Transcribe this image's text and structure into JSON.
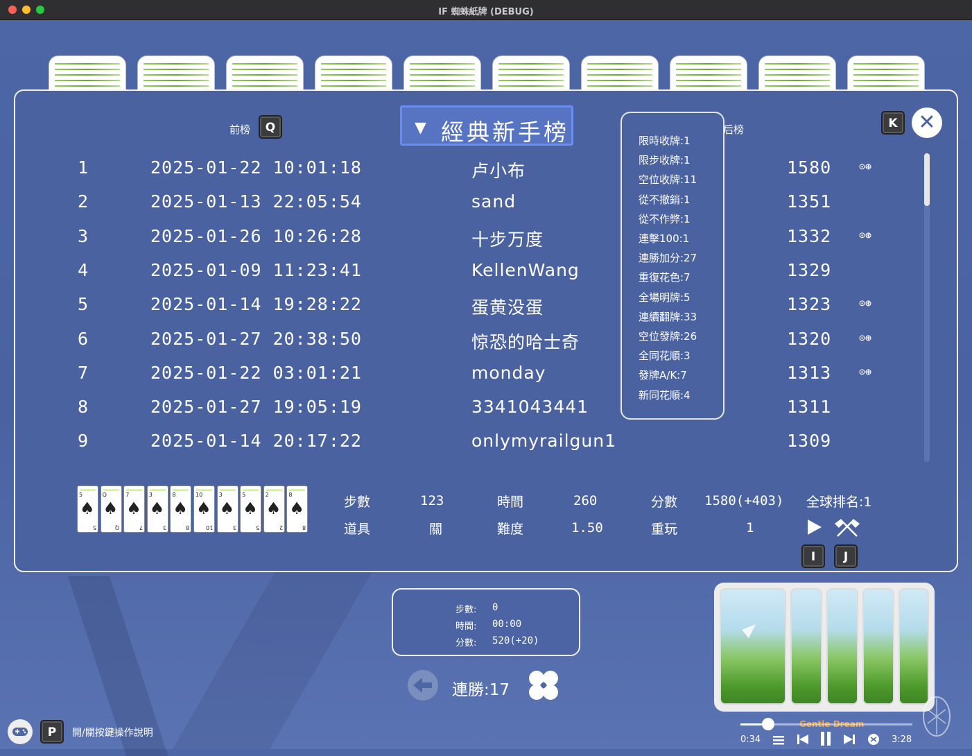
{
  "window": {
    "title": "IF 蜘蛛紙牌 (DEBUG)"
  },
  "leaderboard": {
    "prev_label": "前榜",
    "prev_key": "Q",
    "next_label": "后榜",
    "next_key": "K",
    "title": "經典新手榜",
    "dropdown_glyph": "▼",
    "close_glyph": "✕",
    "replay_glyph": "⊙⊛",
    "rows": [
      {
        "rank": "1",
        "datetime": "2025-01-22 10:01:18",
        "name": "卢小布",
        "score": "1580",
        "replay": true
      },
      {
        "rank": "2",
        "datetime": "2025-01-13 22:05:54",
        "name": "sand",
        "score": "1351",
        "replay": false
      },
      {
        "rank": "3",
        "datetime": "2025-01-26 10:26:28",
        "name": "十步万度",
        "score": "1332",
        "replay": true
      },
      {
        "rank": "4",
        "datetime": "2025-01-09 11:23:41",
        "name": "KellenWang",
        "score": "1329",
        "replay": false
      },
      {
        "rank": "5",
        "datetime": "2025-01-14 19:28:22",
        "name": "蛋黄没蛋",
        "score": "1323",
        "replay": true
      },
      {
        "rank": "6",
        "datetime": "2025-01-27 20:38:50",
        "name": "惊恐的哈士奇",
        "score": "1320",
        "replay": true
      },
      {
        "rank": "7",
        "datetime": "2025-01-22 03:01:21",
        "name": "monday",
        "score": "1313",
        "replay": true
      },
      {
        "rank": "8",
        "datetime": "2025-01-27 19:05:19",
        "name": "3341043441",
        "score": "1311",
        "replay": false
      },
      {
        "rank": "9",
        "datetime": "2025-01-14 20:17:22",
        "name": "onlymyrailgun1",
        "score": "1309",
        "replay": false
      }
    ],
    "bonus_popup": [
      "限時收牌:1",
      "限步收牌:1",
      "空位收牌:11",
      "從不撤銷:1",
      "從不作弊:1",
      "連擊100:1",
      "連勝加分:27",
      "重復花色:7",
      "全場明牌:5",
      "連續翻牌:33",
      "空位發牌:26",
      "全同花順:3",
      "發牌A/K:7",
      "新同花順:4"
    ],
    "mini_cards": [
      {
        "rank": "5",
        "suit": "♠"
      },
      {
        "rank": "Q",
        "suit": "♠"
      },
      {
        "rank": "7",
        "suit": "♠"
      },
      {
        "rank": "3",
        "suit": "♠"
      },
      {
        "rank": "8",
        "suit": "♠"
      },
      {
        "rank": "10",
        "suit": "♠"
      },
      {
        "rank": "3",
        "suit": "♠"
      },
      {
        "rank": "5",
        "suit": "♠"
      },
      {
        "rank": "2",
        "suit": "♠"
      },
      {
        "rank": "8",
        "suit": "♠"
      }
    ],
    "stats": {
      "steps_label": "步數",
      "steps_value": "123",
      "time_label": "時間",
      "time_value": "260",
      "score_label": "分數",
      "score_value": "1580(+403)",
      "global_rank": "全球排名:1",
      "items_label": "道具",
      "level_label": "關",
      "difficulty_label": "難度",
      "difficulty_value": "1.50",
      "replay_label": "重玩",
      "replay_value": "1"
    },
    "key_i": "I",
    "key_j": "J"
  },
  "game": {
    "info": {
      "steps_label": "步數:",
      "steps_value": "0",
      "time_label": "時間:",
      "time_value": "00:00",
      "score_label": "分數:",
      "score_value": "520(+20)"
    },
    "streak": "連勝:17"
  },
  "footer": {
    "help_key": "P",
    "help_text": "開/關按鍵操作說明"
  },
  "music": {
    "track": "Gentle Dream",
    "elapsed": "0:34",
    "total": "3:28",
    "progress": 0.16
  },
  "colors": {
    "accent": "#6b8df0",
    "panel": "#4a62a0",
    "background": "#4d66a6"
  }
}
